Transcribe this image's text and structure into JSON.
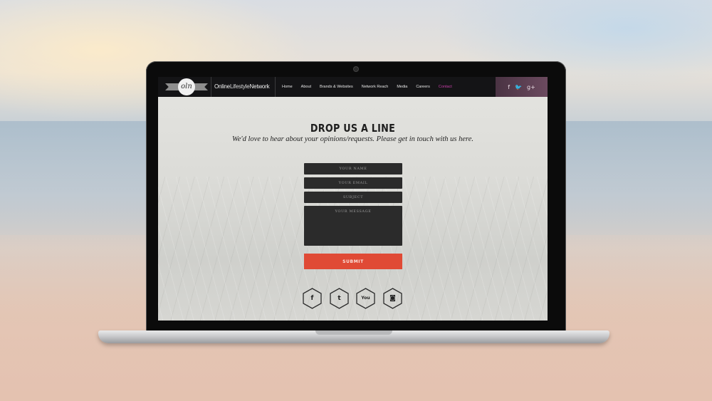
{
  "site": {
    "logo_monogram": "oln",
    "brand": {
      "part1": "Online",
      "part2": "Lifestyle",
      "part3": "Network"
    }
  },
  "nav": {
    "items": [
      {
        "label": "Home"
      },
      {
        "label": "About"
      },
      {
        "label": "Brands & Websites"
      },
      {
        "label": "Network Reach"
      },
      {
        "label": "Media"
      },
      {
        "label": "Careers"
      },
      {
        "label": "Contact",
        "active": true
      }
    ],
    "social": {
      "facebook": "f",
      "twitter": "🐦",
      "google_plus": "g+"
    }
  },
  "contact": {
    "title": "DROP US A LINE",
    "subtitle": "We'd love to hear about your opinions/requests. Please get in touch with us here.",
    "form": {
      "name_placeholder": "YOUR NAME",
      "email_placeholder": "YOUR EMAIL",
      "subject_placeholder": "SUBJECT",
      "message_placeholder": "YOUR MESSAGE",
      "submit_label": "SUBMIT"
    },
    "social_icons": [
      {
        "name": "facebook",
        "glyph": "f"
      },
      {
        "name": "twitter",
        "glyph": "t"
      },
      {
        "name": "youtube",
        "glyph": "You"
      },
      {
        "name": "instagram",
        "glyph": "◙"
      }
    ]
  },
  "colors": {
    "accent": "#e04a35",
    "active_nav": "#c63fa7",
    "nav_bg": "#141416",
    "field_bg": "#2b2b2b"
  }
}
